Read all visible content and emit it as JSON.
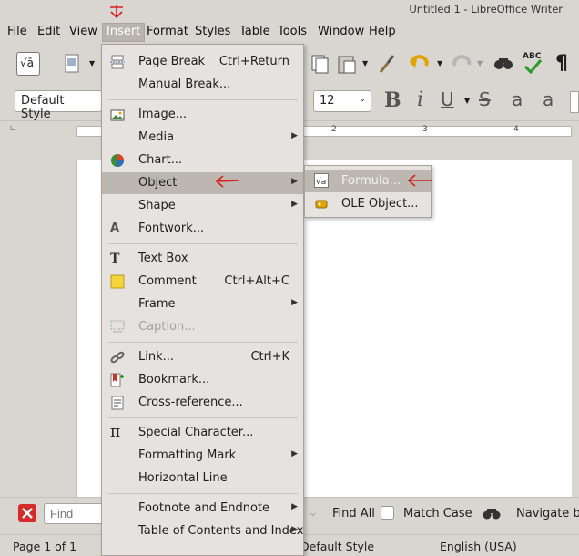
{
  "window": {
    "title": "Untitled 1 - LibreOffice Writer"
  },
  "menubar": [
    "File",
    "Edit",
    "View",
    "Insert",
    "Format",
    "Styles",
    "Table",
    "Tools",
    "Window",
    "Help"
  ],
  "toolbar": {
    "paragraph_style": "Default Style",
    "font_size": "12",
    "math_icon_label": "√ā",
    "spell_label": "ABC"
  },
  "ruler": [
    "2",
    "3",
    "4"
  ],
  "insert_menu": {
    "page_break": "Page Break",
    "page_break_accel": "Ctrl+Return",
    "manual_break": "Manual Break...",
    "image": "Image...",
    "media": "Media",
    "chart": "Chart...",
    "object": "Object",
    "shape": "Shape",
    "fontwork": "Fontwork...",
    "text_box": "Text Box",
    "comment": "Comment",
    "comment_accel": "Ctrl+Alt+C",
    "frame": "Frame",
    "caption": "Caption...",
    "link": "Link...",
    "link_accel": "Ctrl+K",
    "bookmark": "Bookmark...",
    "cross_reference": "Cross-reference...",
    "special_character": "Special Character...",
    "formatting_mark": "Formatting Mark",
    "horizontal_line": "Horizontal Line",
    "footnote": "Footnote and Endnote",
    "toc": "Table of Contents and Index"
  },
  "object_submenu": {
    "formula": "Formula...",
    "ole_object": "OLE Object..."
  },
  "find_bar": {
    "placeholder": "Find",
    "find_all": "Find All",
    "match_case": "Match Case",
    "navigate": "Navigate by"
  },
  "status_bar": {
    "page": "Page 1 of 1",
    "style": "Default Style",
    "language": "English (USA)"
  },
  "colors": {
    "annotation_red": "#d81e1e",
    "highlight": "#bcb7b1"
  }
}
